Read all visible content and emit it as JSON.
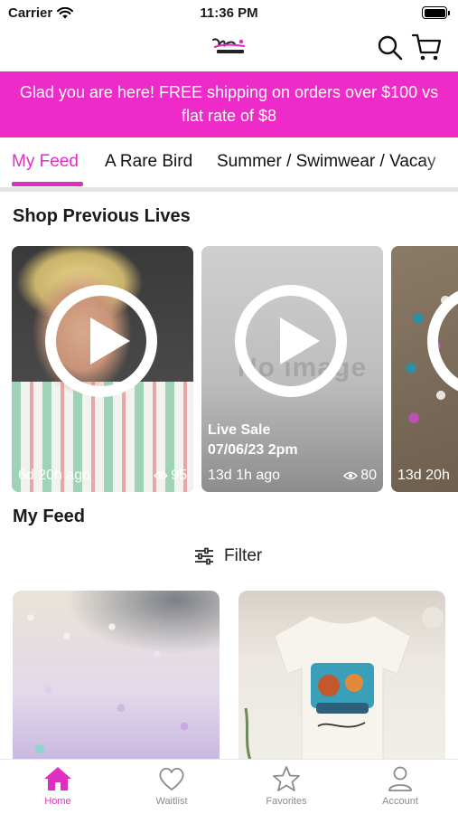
{
  "status_bar": {
    "carrier": "Carrier",
    "time": "11:36 PM"
  },
  "header": {
    "logo_alt": "brand-logo"
  },
  "promo": {
    "text": "Glad you are here!  FREE shipping on orders over $100 vs flat rate of $8"
  },
  "tabs": [
    {
      "label": "My Feed",
      "active": true
    },
    {
      "label": "A Rare Bird",
      "active": false
    },
    {
      "label": "Summer / Swimwear / Vacay",
      "active": false
    }
  ],
  "lives_section": {
    "title": "Shop Previous Lives",
    "cards": [
      {
        "time": "6d 20h ago",
        "views": "95",
        "title_line1": "",
        "title_line2": ""
      },
      {
        "time": "13d 1h ago",
        "views": "80",
        "title_line1": "Live Sale",
        "title_line2": "07/06/23 2pm",
        "placeholder": "No image"
      },
      {
        "time": "13d 20h",
        "views": ""
      }
    ]
  },
  "feed_section": {
    "title": "My Feed",
    "filter_label": "Filter"
  },
  "bottom_nav": [
    {
      "label": "Home",
      "icon": "home-icon",
      "active": true
    },
    {
      "label": "Waitlist",
      "icon": "heart-icon",
      "active": false
    },
    {
      "label": "Favorites",
      "icon": "star-icon",
      "active": false
    },
    {
      "label": "Account",
      "icon": "person-icon",
      "active": false
    }
  ],
  "colors": {
    "accent": "#e12ec2",
    "banner": "#ee2bc9"
  }
}
